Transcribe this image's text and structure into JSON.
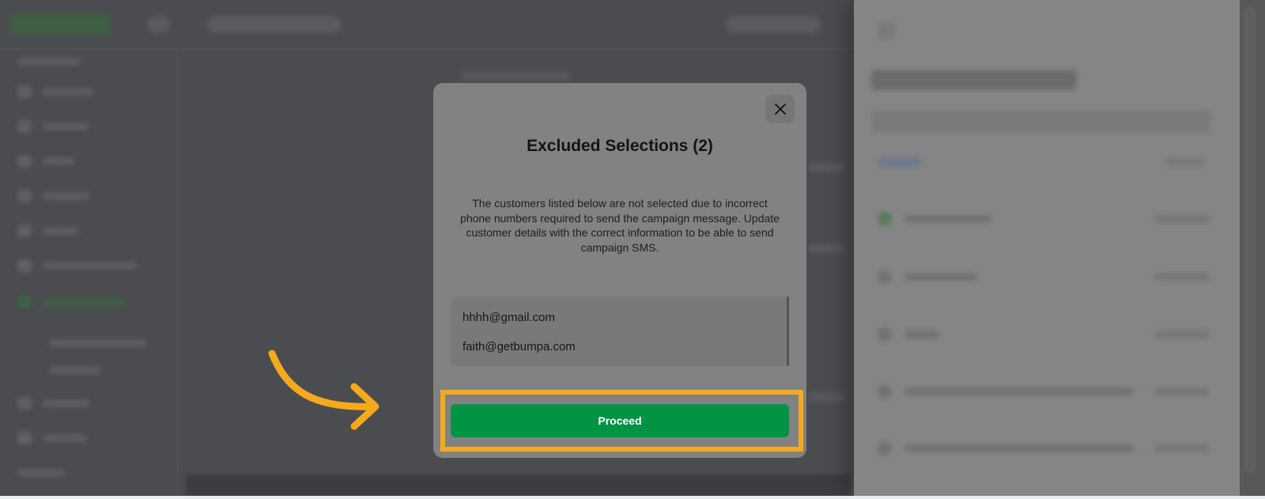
{
  "modal": {
    "title": "Excluded Selections (2)",
    "description": "The customers listed below are not selected due to incorrect phone numbers required to send the campaign message. Update customer details with the correct information to be able to send campaign SMS.",
    "excluded_emails": [
      "hhhh@gmail.com",
      "faith@getbumpa.com"
    ],
    "proceed_label": "Proceed",
    "close_icon": "close-icon"
  },
  "annotation": {
    "highlight_color": "#f5aa1e",
    "arrow_icon": "curved-arrow-icon"
  },
  "colors": {
    "proceed_button": "#029444",
    "modal_background": "#828282",
    "overlay": "#4b4c4f"
  }
}
